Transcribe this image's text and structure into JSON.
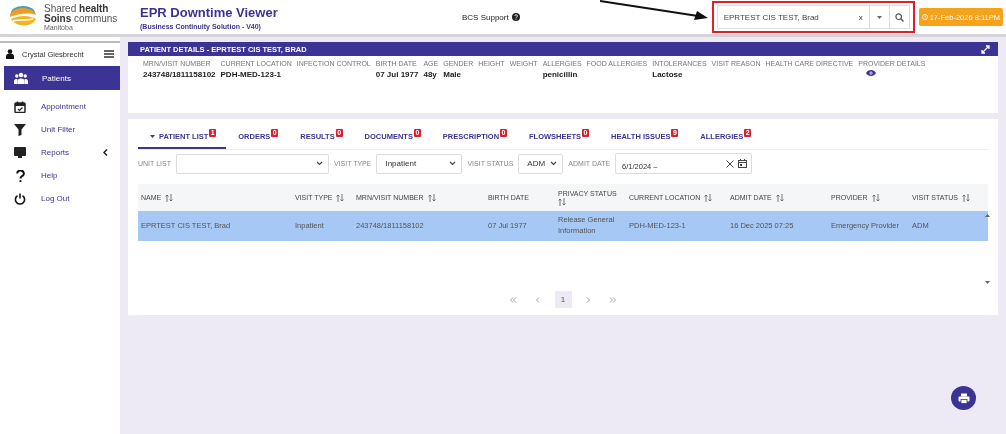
{
  "header": {
    "logo_lines": [
      "Shared **health**",
      "**Soins** communs",
      "Manitoba"
    ],
    "title": "EPR Downtime Viewer",
    "subtitle": "(Business Continuity Solution - V40)",
    "support": "BCS Support",
    "search": {
      "value": "EPRTEST CIS TEST, Brad",
      "clear": "x"
    },
    "timestamp": "17-Feb-2026 8:11PM"
  },
  "sidebar": {
    "user": "Crystal Giesbrecht",
    "items": [
      {
        "label": "Patients",
        "selected": true,
        "submenu": false
      },
      {
        "label": "Appointment",
        "selected": false,
        "submenu": false
      },
      {
        "label": "Unit Filter",
        "selected": false,
        "submenu": false
      },
      {
        "label": "Reports",
        "selected": false,
        "submenu": true
      },
      {
        "label": "Help",
        "selected": false,
        "submenu": false
      },
      {
        "label": "Log Out",
        "selected": false,
        "submenu": false
      }
    ]
  },
  "patient_details": {
    "title": "PATIENT DETAILS - EPRTEST CIS TEST, BRAD",
    "fields": [
      {
        "label": "MRN/VISIT NUMBER",
        "kind": "text",
        "value": "243748/1811158102"
      },
      {
        "label": "CURRENT LOCATION",
        "kind": "text",
        "value": "PDH-MED-123-1"
      },
      {
        "label": "INFECTION CONTROL",
        "kind": "text"
      },
      {
        "label": "BIRTH DATE",
        "kind": "text",
        "value": "07 Jul 1977"
      },
      {
        "label": "AGE",
        "kind": "text",
        "value": "48y"
      },
      {
        "label": "GENDER",
        "kind": "text",
        "value": "Male"
      },
      {
        "label": "HEIGHT",
        "kind": "text"
      },
      {
        "label": "WEIGHT",
        "kind": "text"
      },
      {
        "label": "ALLERGIES",
        "kind": "text",
        "value": "penicillin"
      },
      {
        "label": "FOOD ALLERGIES",
        "kind": "text"
      },
      {
        "label": "INTOLERANCES",
        "kind": "text",
        "value": "Lactose"
      },
      {
        "label": "VISIT REASON",
        "kind": "text"
      },
      {
        "label": "HEALTH CARE DIRECTIVE",
        "kind": "text"
      },
      {
        "label": "PROVIDER DETAILS",
        "kind": "view"
      }
    ]
  },
  "tabs": [
    {
      "label": "PATIENT LIST",
      "count": "1",
      "selected": true,
      "dropdown": true
    },
    {
      "label": "ORDERS",
      "count": "0",
      "selected": false,
      "dropdown": false
    },
    {
      "label": "RESULTS",
      "count": "0",
      "selected": false,
      "dropdown": false
    },
    {
      "label": "DOCUMENTS",
      "count": "0",
      "selected": false,
      "dropdown": false
    },
    {
      "label": "PRESCRIPTION",
      "count": "0",
      "selected": false,
      "dropdown": false
    },
    {
      "label": "FLOWSHEETS",
      "count": "0",
      "selected": false,
      "dropdown": false
    },
    {
      "label": "HEALTH ISSUES",
      "count": "9",
      "selected": false,
      "dropdown": false
    },
    {
      "label": "ALLERGIES",
      "count": "2",
      "selected": false,
      "dropdown": false
    }
  ],
  "filters": [
    {
      "label": "UNIT LIST",
      "kind": "select"
    },
    {
      "label": "VISIT TYPE",
      "kind": "select",
      "value": "Inpatient"
    },
    {
      "label": "VISIT STATUS",
      "kind": "select",
      "value": "ADM"
    },
    {
      "label": "ADMIT DATE",
      "kind": "date",
      "value": "6/1/2024 –"
    }
  ],
  "table": {
    "columns": [
      {
        "label": "NAME",
        "sortable": true
      },
      {
        "label": "VISIT TYPE",
        "sortable": true
      },
      {
        "label": "MRN/VISIT NUMBER",
        "sortable": true
      },
      {
        "label": "BIRTH DATE",
        "sortable": false
      },
      {
        "label": "PRIVACY STATUS",
        "sortable": true
      },
      {
        "label": "CURRENT LOCATION",
        "sortable": true
      },
      {
        "label": "ADMIT DATE",
        "sortable": true
      },
      {
        "label": "PROVIDER",
        "sortable": true
      },
      {
        "label": "VISIT STATUS",
        "sortable": true
      }
    ],
    "rows": [
      {
        "selected": true,
        "cells": [
          "EPRTEST CIS TEST, Brad",
          "Inpatient",
          "243748/1811158102",
          "07 Jul 1977",
          "Release General Information",
          "PDH-MED-123-1",
          "16 Dec 2025 07:25",
          "Emergency Provider",
          "ADM"
        ]
      }
    ]
  },
  "pagination": {
    "pages": [
      {
        "label": "1",
        "selected": true
      }
    ]
  }
}
